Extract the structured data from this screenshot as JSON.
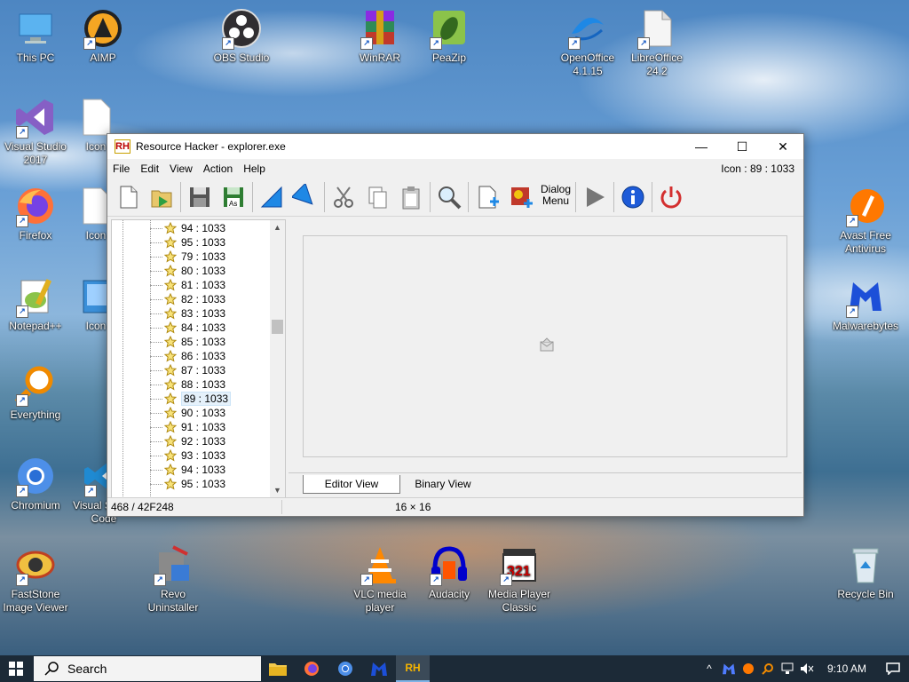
{
  "desktop": {
    "icons": [
      {
        "label": "This PC"
      },
      {
        "label": "AIMP"
      },
      {
        "label": "OBS Studio"
      },
      {
        "label": "WinRAR"
      },
      {
        "label": "PeaZip"
      },
      {
        "label": "OpenOffice 4.1.15"
      },
      {
        "label": "LibreOffice 24.2"
      },
      {
        "label": "Visual Studio 2017"
      },
      {
        "label": "Icon"
      },
      {
        "label": "Firefox"
      },
      {
        "label": "Icon"
      },
      {
        "label": "Notepad++"
      },
      {
        "label": "Icon"
      },
      {
        "label": "Everything"
      },
      {
        "label": "Chromium"
      },
      {
        "label": "Visual Studio Code"
      },
      {
        "label": "Avast Free Antivirus"
      },
      {
        "label": "Malwarebytes"
      },
      {
        "label": "FastStone Image Viewer"
      },
      {
        "label": "Revo Uninstaller"
      },
      {
        "label": "VLC media player"
      },
      {
        "label": "Audacity"
      },
      {
        "label": "Media Player Classic"
      },
      {
        "label": "Recycle Bin"
      }
    ]
  },
  "window": {
    "app_icon": "RH",
    "title": "Resource Hacker - explorer.exe",
    "controls": {
      "minimize": "—",
      "maximize": "☐",
      "close": "✕"
    },
    "menu": [
      "File",
      "Edit",
      "View",
      "Action",
      "Help"
    ],
    "status_right": "Icon : 89 : 1033",
    "toolbar": {
      "dialog_label_1": "Dialog",
      "dialog_label_2": "Menu"
    },
    "tree": {
      "items": [
        "94 : 1033",
        "95 : 1033",
        "79 : 1033",
        "80 : 1033",
        "81 : 1033",
        "82 : 1033",
        "83 : 1033",
        "84 : 1033",
        "85 : 1033",
        "86 : 1033",
        "87 : 1033",
        "88 : 1033",
        "89 : 1033",
        "90 : 1033",
        "91 : 1033",
        "92 : 1033",
        "93 : 1033",
        "94 : 1033",
        "95 : 1033"
      ],
      "selected_index": 12
    },
    "tabs": {
      "editor": "Editor View",
      "binary": "Binary View"
    },
    "statusbar": {
      "offset": "468 / 42F248",
      "size": "16 × 16"
    }
  },
  "taskbar": {
    "search_placeholder": "Search",
    "clock": "9:10 AM"
  },
  "colors": {
    "taskbar": "#1c2a37",
    "selection": "#e5f1fb",
    "accent": "#0078d7"
  }
}
